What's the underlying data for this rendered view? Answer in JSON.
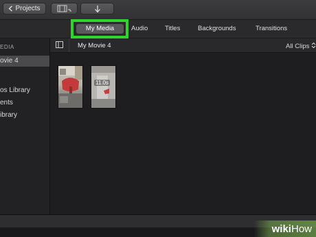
{
  "toolbar": {
    "projects_label": "Projects",
    "icons": [
      "chevron-left-icon",
      "media-filmstrip-icon",
      "import-arrow-icon"
    ]
  },
  "tabs": [
    {
      "label": "My Media",
      "selected": true
    },
    {
      "label": "Audio"
    },
    {
      "label": "Titles"
    },
    {
      "label": "Backgrounds"
    },
    {
      "label": "Transitions"
    }
  ],
  "sidebar": {
    "header": "EDIA",
    "items": [
      {
        "label": "ovie 4",
        "selected": true
      },
      {
        "label": "os Library"
      },
      {
        "label": "ents"
      },
      {
        "label": "ibrary"
      }
    ]
  },
  "browser": {
    "event_title": "My Movie 4",
    "filter": "All Clips",
    "clips": [
      {
        "duration": ""
      },
      {
        "duration": "11.0s"
      }
    ]
  },
  "watermark": {
    "bold": "wiki",
    "light": "How"
  },
  "colors": {
    "highlight": "#2cd62a",
    "background": "#1c1c1e",
    "selected_tab": "#5a5a5e"
  }
}
